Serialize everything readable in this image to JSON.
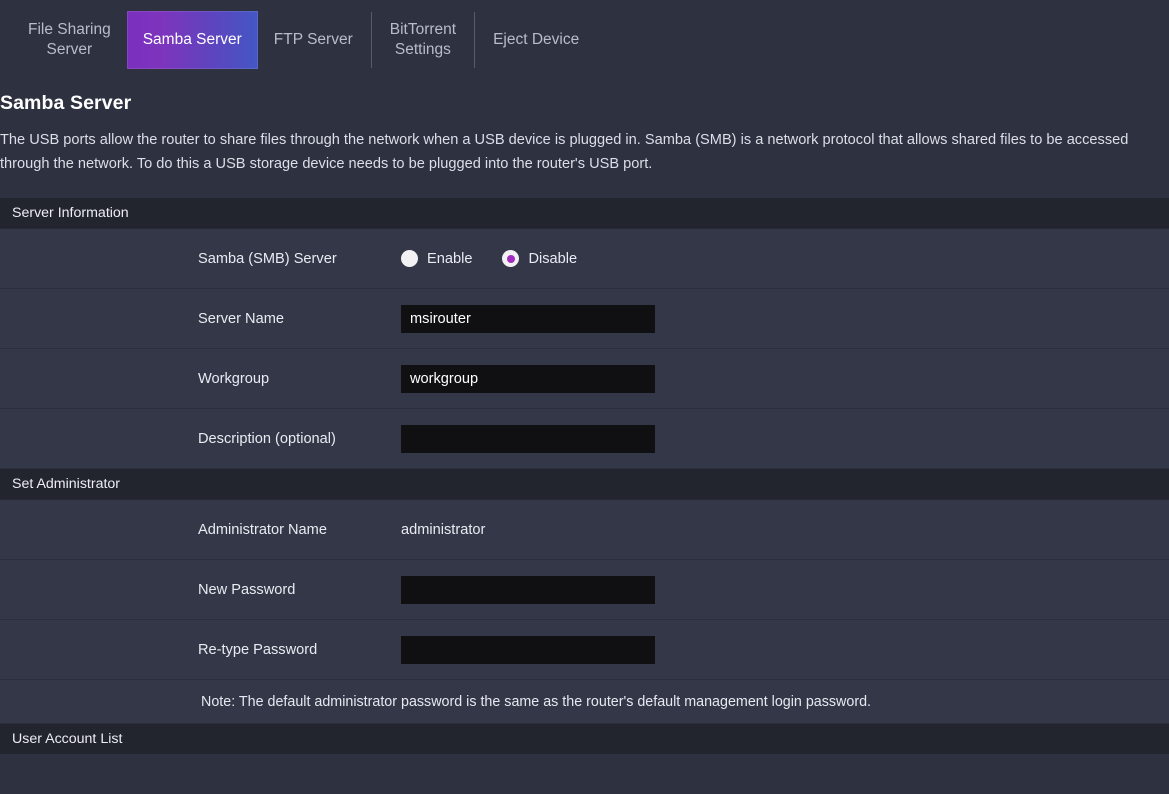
{
  "tabs": [
    {
      "label": "File Sharing\nServer",
      "active": false,
      "sep_after": false
    },
    {
      "label": "Samba Server",
      "active": true,
      "sep_after": false
    },
    {
      "label": "FTP Server",
      "active": false,
      "sep_after": true
    },
    {
      "label": "BitTorrent\nSettings",
      "active": false,
      "sep_after": true
    },
    {
      "label": "Eject Device",
      "active": false,
      "sep_after": false
    }
  ],
  "page": {
    "title": "Samba Server",
    "description": "The USB ports allow the router to share files through the network when a USB device is plugged in. Samba (SMB) is a network protocol that allows shared files to be accessed through the network. To do this a USB storage device needs to be plugged into the router's USB port."
  },
  "server_information": {
    "heading": "Server Information",
    "samba_label": "Samba (SMB) Server",
    "radio_enable": "Enable",
    "radio_disable": "Disable",
    "selected": "Disable",
    "server_name_label": "Server Name",
    "server_name_value": "msirouter",
    "workgroup_label": "Workgroup",
    "workgroup_value": "workgroup",
    "description_label": "Description (optional)",
    "description_value": ""
  },
  "set_administrator": {
    "heading": "Set Administrator",
    "admin_name_label": "Administrator Name",
    "admin_name_value": "administrator",
    "new_password_label": "New Password",
    "new_password_value": "",
    "retype_password_label": "Re-type Password",
    "retype_password_value": "",
    "note": "Note: The default administrator password is the same as the router's default management login password."
  },
  "user_account_list": {
    "heading": "User Account List"
  },
  "colors": {
    "page_bg": "#2e3140",
    "row_bg": "#333748",
    "section_head_bg": "#22242e",
    "input_bg": "#101012",
    "accent_purple": "#a32cc0",
    "tab_gradient_start": "#7b2fbe",
    "tab_gradient_end": "#4457c4"
  }
}
